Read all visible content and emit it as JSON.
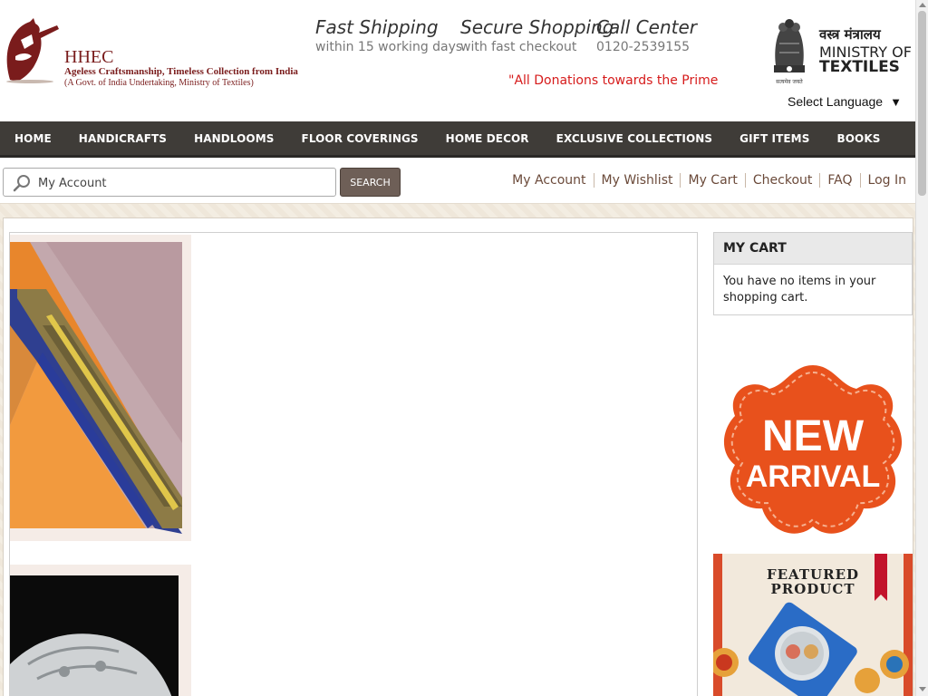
{
  "header": {
    "logo_name": "HHEC",
    "logo_tagline": "Ageless Craftsmanship, Timeless Collection from India",
    "logo_subtitle": "(A Govt. of India Undertaking, Ministry of Textiles)",
    "features": [
      {
        "title": "Fast Shipping",
        "subtitle": "within 15 working days"
      },
      {
        "title": "Secure Shopping",
        "subtitle": "with fast checkout"
      },
      {
        "title": "Call Center",
        "subtitle": "0120-2539155"
      }
    ],
    "marquee": "\"All Donations towards the Prime mi",
    "ministry_hindi": "वस्त्र मंत्रालय",
    "ministry_line1": "MINISTRY OF",
    "ministry_line2": "TEXTILES",
    "emblem_motto": "सत्यमेव जयते",
    "language_label": "Select Language",
    "language_arrow": "▼"
  },
  "nav": {
    "items": [
      "HOME",
      "HANDICRAFTS",
      "HANDLOOMS",
      "FLOOR COVERINGS",
      "HOME DECOR",
      "EXCLUSIVE COLLECTIONS",
      "GIFT ITEMS",
      "BOOKS"
    ]
  },
  "search": {
    "value": "My Account",
    "button_label": "SEARCH"
  },
  "toplinks": [
    "My Account",
    "My Wishlist",
    "My Cart",
    "Checkout",
    "FAQ",
    "Log In"
  ],
  "cart": {
    "title": "MY CART",
    "empty_message": "You have no items in your shopping cart."
  },
  "promo": {
    "new_line1": "NEW",
    "new_line2": "ARRIVAL",
    "featured_line1": "FEATURED",
    "featured_line2": "PRODUCT"
  },
  "colors": {
    "nav_bg": "#3f3c38",
    "brand_maroon": "#7a1c1c",
    "marquee_red": "#d61b1b",
    "promo_orange": "#e8511c",
    "search_button": "#6e5f57"
  }
}
